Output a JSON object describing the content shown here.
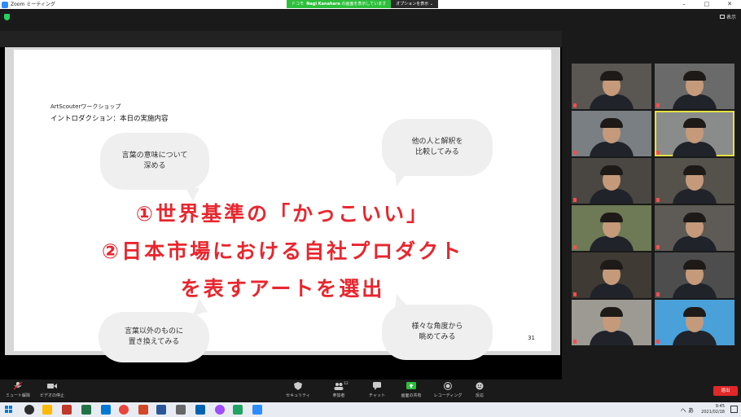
{
  "window": {
    "title": "Zoom ミーティング",
    "minimize": "–",
    "maximize": "□",
    "close": "✕"
  },
  "share_banner": {
    "prefix": "ドコモ",
    "name": "Nagi Kanahara",
    "suffix": "の画面を表示しています",
    "options": "オプションを表示 ⌄"
  },
  "topbar": {
    "view_label": "表示"
  },
  "slide": {
    "brand": "ArtScouterワークショップ",
    "subtitle": "イントロダクション：本日の実施内容",
    "bubbles": [
      {
        "line1": "言葉の意味について",
        "line2": "深める"
      },
      {
        "line1": "他の人と解釈を",
        "line2": "比較してみる"
      },
      {
        "line1": "言葉以外のものに",
        "line2": "置き換えてみる"
      },
      {
        "line1": "様々な角度から",
        "line2": "眺めてみる"
      }
    ],
    "main_lines": [
      "①世界基準の「かっこいい」",
      "②日本市場における自社プロダクト",
      "を表すアートを選出"
    ],
    "page_number": "31"
  },
  "toolbar": {
    "mute": "ミュート解除",
    "video": "ビデオの停止",
    "security": "セキュリティ",
    "participants": "参加者",
    "participant_count": "12",
    "chat": "チャット",
    "share": "画面の共有",
    "record": "レコーディング",
    "reactions": "反応",
    "leave": "退出"
  },
  "taskbar": {
    "ime": "へ あ",
    "time": "9:45",
    "date": "2021/02/18"
  },
  "colors": {
    "accent_red": "#e8262e",
    "share_green": "#2dbf3c",
    "zoom_blue": "#2d8cff"
  }
}
